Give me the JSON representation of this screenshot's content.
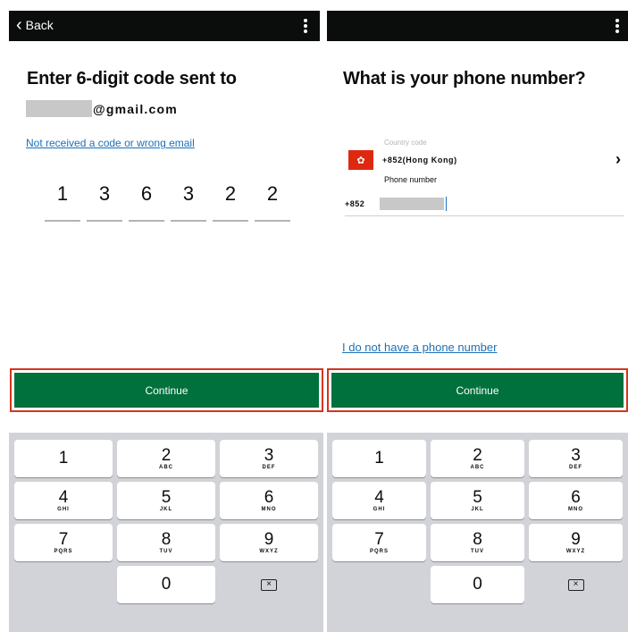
{
  "left": {
    "back_label": "Back",
    "title": "Enter 6-digit code sent to",
    "email_domain": "@gmail.com",
    "resend_link": "Not received a code or wrong email",
    "code": [
      "1",
      "3",
      "6",
      "3",
      "2",
      "2"
    ],
    "continue_label": "Continue"
  },
  "right": {
    "title": "What is your phone number?",
    "country_label": "Country code",
    "country_value": "+852(Hong Kong)",
    "flag_icon": "hong-kong-flag-icon",
    "flag_color": "#de2910",
    "phone_label": "Phone number",
    "phone_prefix": "+852",
    "no_phone_link": "I do not have a phone number",
    "continue_label": "Continue"
  },
  "keypad": {
    "rows": [
      [
        {
          "num": "1",
          "letters": ""
        },
        {
          "num": "2",
          "letters": "ABC"
        },
        {
          "num": "3",
          "letters": "DEF"
        }
      ],
      [
        {
          "num": "4",
          "letters": "GHI"
        },
        {
          "num": "5",
          "letters": "JKL"
        },
        {
          "num": "6",
          "letters": "MNO"
        }
      ],
      [
        {
          "num": "7",
          "letters": "PQRS"
        },
        {
          "num": "8",
          "letters": "TUV"
        },
        {
          "num": "9",
          "letters": "WXYZ"
        }
      ]
    ],
    "zero": "0",
    "delete_icon": "backspace-icon"
  },
  "colors": {
    "topbar": "#0b0c0c",
    "button_green": "#00703c",
    "focus_red": "#d4351c",
    "link_blue": "#1d70b8",
    "keypad_bg": "#d1d3d8"
  }
}
